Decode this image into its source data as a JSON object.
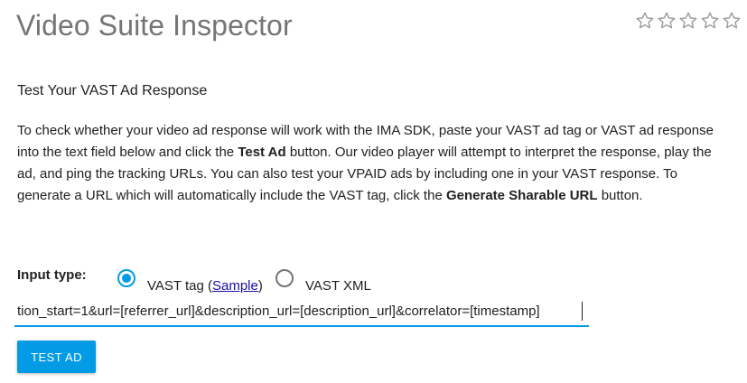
{
  "header": {
    "title": "Video Suite Inspector",
    "rating": {
      "value": 0,
      "max": 5,
      "icon": "star-outline-icon"
    }
  },
  "main": {
    "subtitle": "Test Your VAST Ad Response",
    "description": {
      "part1": "To check whether your video ad response will work with the IMA SDK, paste your VAST ad tag or VAST ad response into the text field below and click the ",
      "bold1": "Test Ad",
      "part2": " button. Our video player will attempt to interpret the response, play the ad, and ping the tracking URLs. You can also test your VPAID ads by including one in your VAST response. To generate a URL which will automatically include the VAST tag, click the ",
      "bold2": "Generate Sharable URL",
      "part3": " button."
    },
    "input_type": {
      "label": "Input type:",
      "options": {
        "vast_tag": {
          "text_before": "VAST tag (",
          "link": "Sample",
          "text_after": ")",
          "selected": true
        },
        "vast_xml": {
          "text": "VAST XML",
          "selected": false
        }
      }
    },
    "tag_input": {
      "value": "tion_start=1&url=[referrer_url]&description_url=[description_url]&correlator=[timestamp]"
    },
    "test_button": {
      "label": "TEST AD"
    }
  },
  "colors": {
    "accent": "#039be5",
    "title_gray": "#757575",
    "link": "#1a0dab"
  }
}
